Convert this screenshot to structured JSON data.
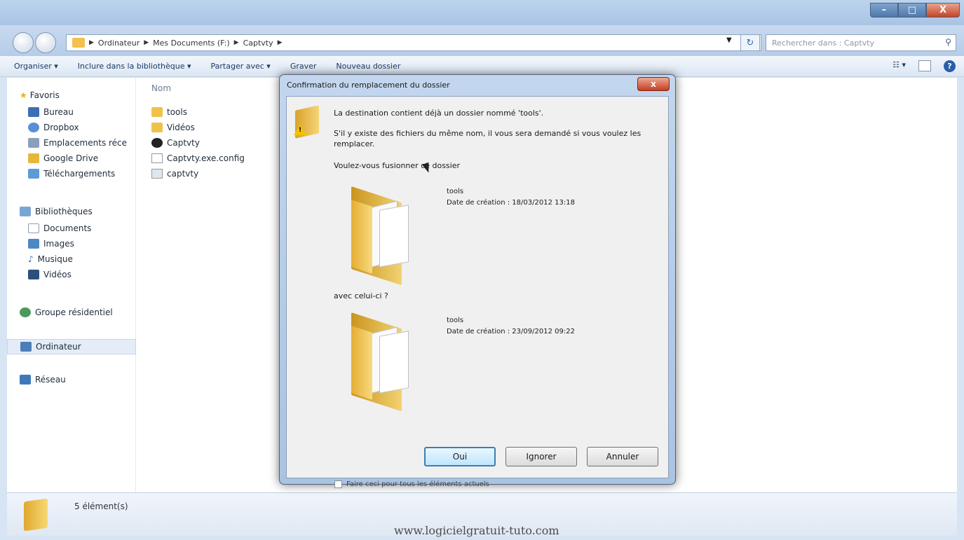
{
  "window": {
    "controls": {
      "minimize": "–",
      "maximize": "□",
      "close": "X"
    }
  },
  "address": {
    "crumbs": [
      "Ordinateur",
      "Mes Documents (F:)",
      "Captvty"
    ],
    "search_placeholder": "Rechercher dans : Captvty"
  },
  "toolbar": {
    "organize": "Organiser ▾",
    "include_library": "Inclure dans la bibliothèque ▾",
    "share": "Partager avec ▾",
    "burn": "Graver",
    "new_folder": "Nouveau dossier"
  },
  "nav": {
    "favorites": "Favoris",
    "favorites_items": [
      "Bureau",
      "Dropbox",
      "Emplacements réce",
      "Google Drive",
      "Téléchargements"
    ],
    "libraries": "Bibliothèques",
    "libraries_items": [
      "Documents",
      "Images",
      "Musique",
      "Vidéos"
    ],
    "homegroup": "Groupe résidentiel",
    "computer": "Ordinateur",
    "network": "Réseau"
  },
  "files": {
    "column_name": "Nom",
    "items": [
      "tools",
      "Vidéos",
      "Captvty",
      "Captvty.exe.config",
      "captvty"
    ]
  },
  "status": {
    "count": "5 élément(s)"
  },
  "dialog": {
    "title": "Confirmation du remplacement du dossier",
    "close": "x",
    "line1": "La destination contient déjà un dossier nommé 'tools'.",
    "line2a": "S'il y existe des fichiers du même nom, il vous sera demandé si vous voulez les",
    "line2b": "remplacer.",
    "line3": "Voulez-vous fusionner ce dossier",
    "dest_folder": {
      "name": "tools",
      "created": "Date de création : 18/03/2012 13:18"
    },
    "with_label": "avec celui-ci ?",
    "source_folder": {
      "name": "tools",
      "created": "Date de création : 23/09/2012 09:22"
    },
    "btn_yes": "Oui",
    "btn_ignore": "Ignorer",
    "btn_cancel": "Annuler",
    "apply_all": "Faire ceci pour tous les éléments actuels"
  },
  "watermark": "www.logicielgratuit-tuto.com"
}
